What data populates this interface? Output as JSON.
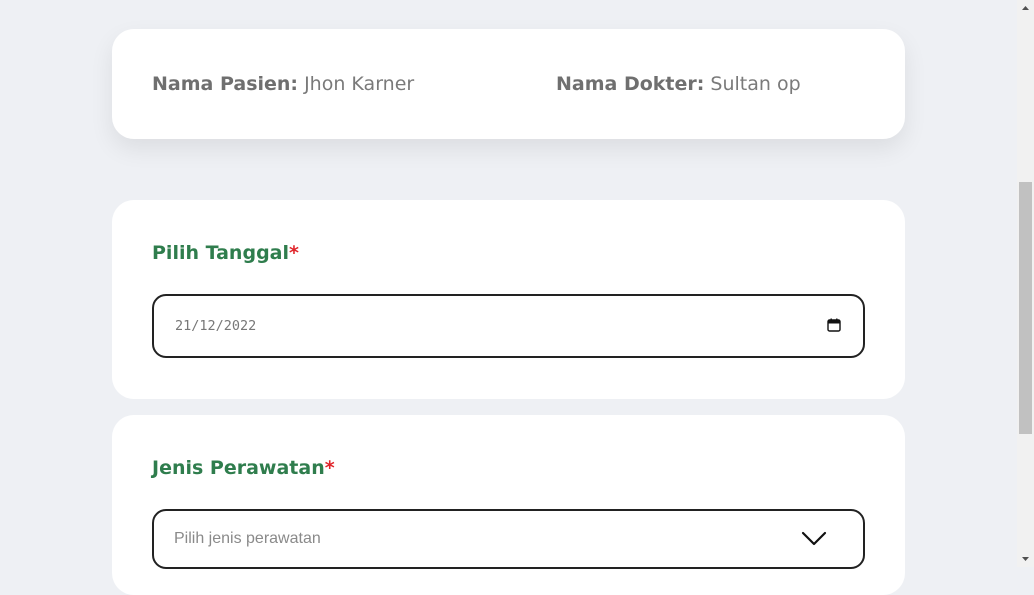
{
  "patient_info": {
    "patient_label": "Nama Pasien:",
    "patient_name": "Jhon Karner",
    "doctor_label": "Nama Dokter:",
    "doctor_name": "Sultan op"
  },
  "date_field": {
    "label": "Pilih Tanggal",
    "required_mark": "*",
    "value": "21/12/2022",
    "icon": "calendar-icon"
  },
  "treatment_field": {
    "label": "Jenis Perawatan",
    "required_mark": "*",
    "placeholder": "Pilih jenis perawatan",
    "icon": "chevron-down-icon"
  },
  "colors": {
    "background": "#eef0f4",
    "card": "#ffffff",
    "label_green": "#2f7d4d",
    "required_red": "#e0242a"
  }
}
